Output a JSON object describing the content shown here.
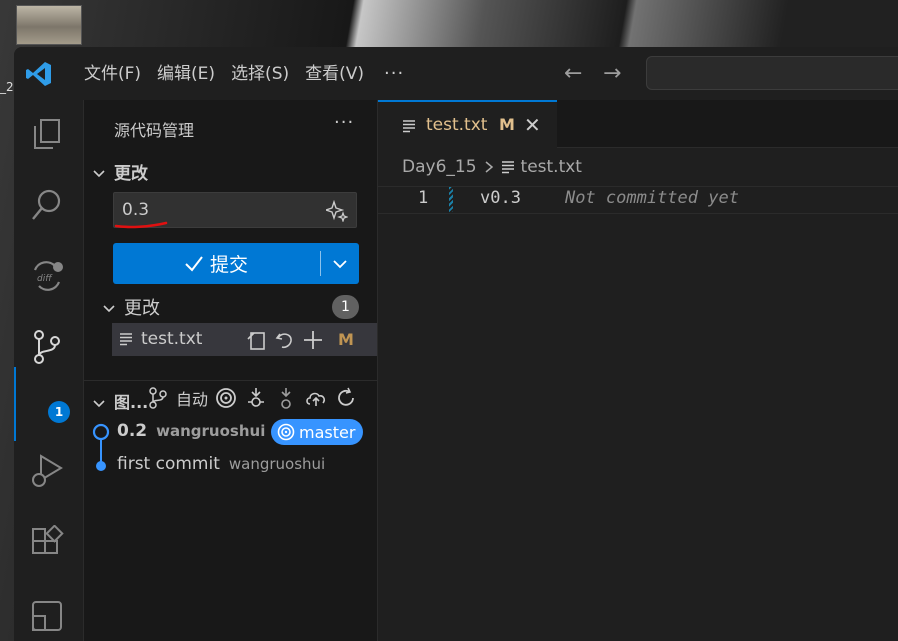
{
  "menu": [
    "文件(F)",
    "编辑(E)",
    "选择(S)",
    "查看(V)"
  ],
  "menu_more": "···",
  "activity": {
    "items": [
      "explorer-icon",
      "search-icon",
      "diff-icon",
      "source-control-icon",
      "run-debug-icon",
      "extensions-icon",
      "remote-icon"
    ],
    "scm_badge": "1"
  },
  "sidebar": {
    "title": "源代码管理",
    "more": "···",
    "section_changes": "更改",
    "commit_message": "0.3",
    "commit_button": "提交",
    "changes_group": "更改",
    "changes_count": "1",
    "file": {
      "name": "test.txt",
      "status": "M"
    },
    "graph": {
      "title": "图...",
      "auto_label": "自动",
      "commits": [
        {
          "message": "0.2",
          "author": "wangruoshui",
          "branch": "master"
        },
        {
          "message": "first commit",
          "author": "wangruoshui"
        }
      ]
    }
  },
  "editor": {
    "tab": {
      "name": "test.txt",
      "status": "M"
    },
    "breadcrumb": [
      "Day6_15",
      "test.txt"
    ],
    "line_number": "1",
    "code": "v0.3",
    "blame": "Not committed yet"
  },
  "colors": {
    "accent": "#0078d4",
    "branch": "#3794ff",
    "modified": "#e2c08d"
  }
}
